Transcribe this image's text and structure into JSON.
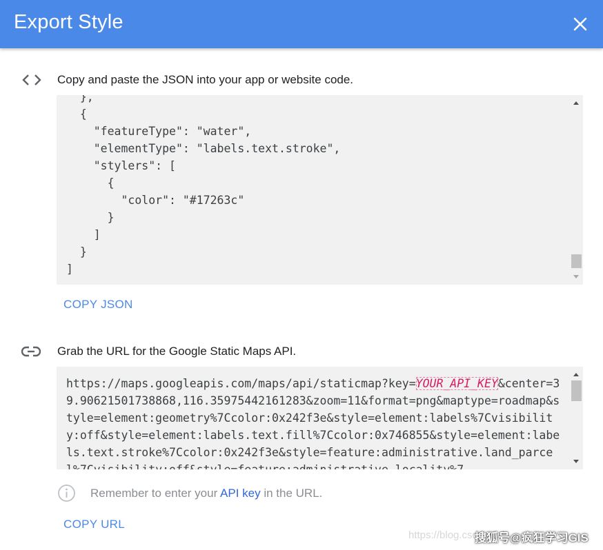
{
  "dialog": {
    "title": "Export Style",
    "close_icon": "close-icon"
  },
  "json_section": {
    "icon": "code-icon",
    "label": "Copy and paste the JSON into your app or website code.",
    "code_lines": [
      "  },",
      "  {",
      "    \"featureType\": \"water\",",
      "    \"elementType\": \"labels.text.stroke\",",
      "    \"stylers\": [",
      "      {",
      "        \"color\": \"#17263c\"",
      "      }",
      "    ]",
      "  }",
      "]"
    ],
    "scroll_fraction": 0.98,
    "copy_label": "COPY JSON"
  },
  "url_section": {
    "icon": "link-icon",
    "label": "Grab the URL for the Google Static Maps API.",
    "url_prefix": "https://maps.googleapis.com/maps/api/staticmap?key=",
    "api_key_placeholder": "YOUR_API_KEY",
    "url_rest": "&center=39.90621501738868,116.35975442161283&zoom=11&format=png&maptype=roadmap&style=element:geometry%7Ccolor:0x242f3e&style=element:labels%7Cvisibility:off&style=element:labels.text.fill%7Ccolor:0x746855&style=element:labels.text.stroke%7Ccolor:0x242f3e&style=feature:administrative.land_parcel%7Cvisibility:off&style=feature:administrative.locality%7",
    "scroll_fraction": 0.0,
    "info_icon": "info-icon",
    "info_before": "Remember to enter your ",
    "info_link": "API key",
    "info_after": " in the URL.",
    "copy_label": "COPY URL"
  },
  "watermark": {
    "text": "https://blog.csdn.net/",
    "badge": "搜狐号@疯狂学习GIS"
  },
  "colors": {
    "header": "#4a89e8",
    "link": "#4a89e8",
    "code_background": "#f1f1f1",
    "api_key": "#d81b60"
  }
}
